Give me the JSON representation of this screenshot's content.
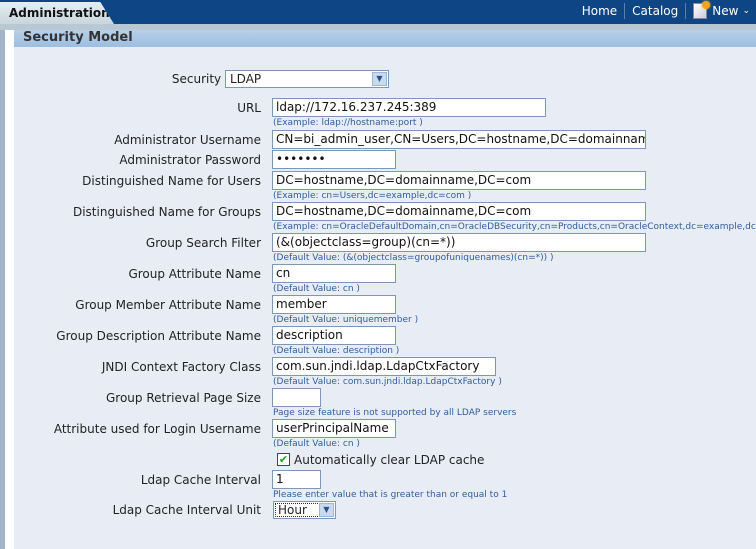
{
  "header": {
    "active_tab": "Administration",
    "nav": {
      "home": "Home",
      "catalog": "Catalog",
      "new": "New"
    }
  },
  "panel": {
    "title": "Security Model"
  },
  "form": {
    "security_model": {
      "label": "Security Model",
      "value": "LDAP"
    },
    "url": {
      "label": "URL",
      "value": "ldap://172.16.237.245:389",
      "hint": "(Example: ldap://hostname:port )"
    },
    "admin_username": {
      "label": "Administrator Username",
      "value": "CN=bi_admin_user,CN=Users,DC=hostname,DC=domainname,DC=com"
    },
    "admin_password": {
      "label": "Administrator Password",
      "value": "•••••••"
    },
    "dn_users": {
      "label": "Distinguished Name for Users",
      "value": "DC=hostname,DC=domainname,DC=com",
      "hint": "(Example: cn=Users,dc=example,dc=com )"
    },
    "dn_groups": {
      "label": "Distinguished Name for Groups",
      "value": "DC=hostname,DC=domainname,DC=com",
      "hint": "(Example: cn=OracleDefaultDomain,cn=OracleDBSecurity,cn=Products,cn=OracleContext,dc=example,dc=com )"
    },
    "group_search_filter": {
      "label": "Group Search Filter",
      "value": "(&(objectclass=group)(cn=*))",
      "hint": "(Default Value: (&(objectclass=groupofuniquenames)(cn=*)) )"
    },
    "group_attr_name": {
      "label": "Group Attribute Name",
      "value": "cn",
      "hint": "(Default Value: cn )"
    },
    "group_member_attr": {
      "label": "Group Member Attribute Name",
      "value": "member",
      "hint": "(Default Value: uniquemember )"
    },
    "group_desc_attr": {
      "label": "Group Description Attribute Name",
      "value": "description",
      "hint": "(Default Value: description )"
    },
    "jndi_factory": {
      "label": "JNDI Context Factory Class",
      "value": "com.sun.jndi.ldap.LdapCtxFactory",
      "hint": "(Default Value: com.sun.jndi.ldap.LdapCtxFactory )"
    },
    "group_page_size": {
      "label": "Group Retrieval Page Size",
      "value": "",
      "hint": "Page size feature is not supported by all LDAP servers"
    },
    "login_attr": {
      "label": "Attribute used for Login Username",
      "value": "userPrincipalName",
      "hint": "(Default Value: cn )"
    },
    "auto_clear_cache": {
      "label": "Automatically clear LDAP cache",
      "checked": true
    },
    "cache_interval": {
      "label": "Ldap Cache Interval",
      "value": "1",
      "hint": "Please enter value that is greater than or equal to 1"
    },
    "cache_interval_unit": {
      "label": "Ldap Cache Interval Unit",
      "value": "Hour"
    }
  }
}
